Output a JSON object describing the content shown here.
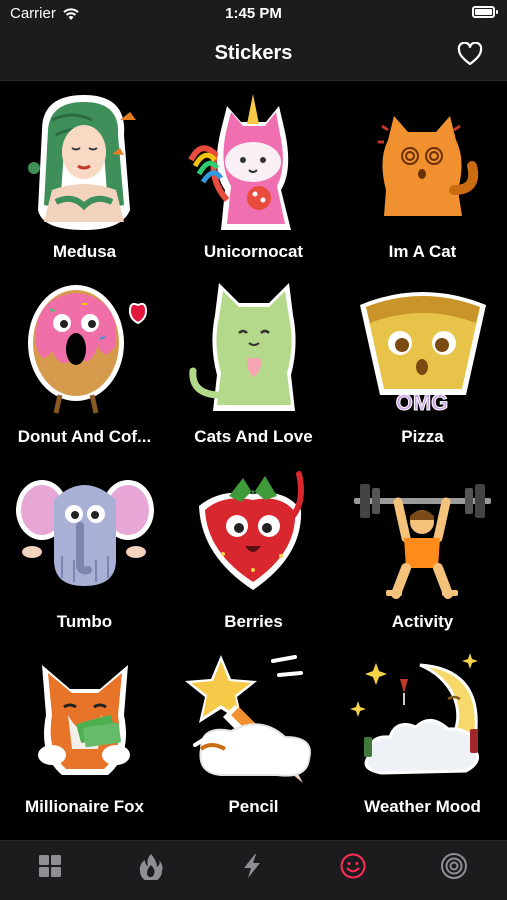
{
  "status": {
    "carrier": "Carrier",
    "time": "1:45 PM"
  },
  "header": {
    "title": "Stickers"
  },
  "stickers": [
    {
      "name": "Medusa"
    },
    {
      "name": "Unicornocat"
    },
    {
      "name": "Im A Cat"
    },
    {
      "name": "Donut And Cof..."
    },
    {
      "name": "Cats And Love"
    },
    {
      "name": "Pizza"
    },
    {
      "name": "Tumbo"
    },
    {
      "name": "Berries"
    },
    {
      "name": "Activity"
    },
    {
      "name": "Millionaire Fox"
    },
    {
      "name": "Pencil"
    },
    {
      "name": "Weather Mood"
    }
  ],
  "tabs": [
    {
      "icon": "grid-icon",
      "active": false
    },
    {
      "icon": "flame-icon",
      "active": false
    },
    {
      "icon": "lightning-icon",
      "active": false
    },
    {
      "icon": "smiley-icon",
      "active": true
    },
    {
      "icon": "target-icon",
      "active": false
    }
  ],
  "colors": {
    "active_tab": "#ff2d55",
    "inactive_tab": "#8e8e93",
    "bar_background": "#1c1c1e"
  }
}
